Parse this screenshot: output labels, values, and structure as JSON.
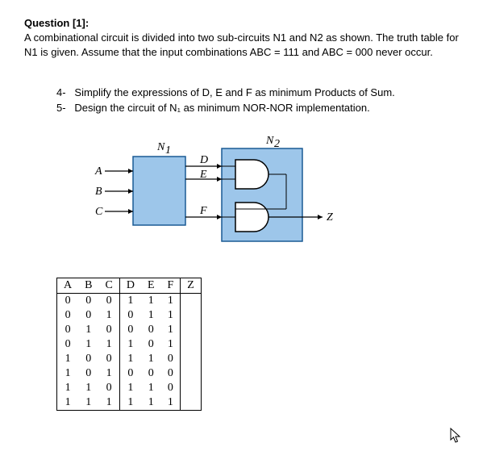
{
  "question": {
    "label": "Question [1]:",
    "text_line1": "A combinational circuit is divided into two sub-circuits N1 and N2 as shown.  The truth table for",
    "text_line2": "N1 is given.  Assume that the input combinations ABC = 111 and   ABC = 000 never occur."
  },
  "tasks": {
    "t4_num": "4-",
    "t4": "Simplify the expressions of  D, E and F as minimum Products of Sum.",
    "t5_num": "5-",
    "t5": "Design the circuit of N₁ as minimum NOR-NOR implementation."
  },
  "diagram": {
    "n1": "N₁",
    "n2": "N₂",
    "A": "A",
    "B": "B",
    "C": "C",
    "D": "D",
    "E": "E",
    "F": "F",
    "Z": "Z"
  },
  "table": {
    "headers": [
      "A",
      "B",
      "C",
      "D",
      "E",
      "F",
      "Z"
    ],
    "rows": [
      [
        "0",
        "0",
        "0",
        "1",
        "1",
        "1",
        ""
      ],
      [
        "0",
        "0",
        "1",
        "0",
        "1",
        "1",
        ""
      ],
      [
        "0",
        "1",
        "0",
        "0",
        "0",
        "1",
        ""
      ],
      [
        "0",
        "1",
        "1",
        "1",
        "0",
        "1",
        ""
      ],
      [
        "1",
        "0",
        "0",
        "1",
        "1",
        "0",
        ""
      ],
      [
        "1",
        "0",
        "1",
        "0",
        "0",
        "0",
        ""
      ],
      [
        "1",
        "1",
        "0",
        "1",
        "1",
        "0",
        ""
      ],
      [
        "1",
        "1",
        "1",
        "1",
        "1",
        "1",
        ""
      ]
    ]
  }
}
